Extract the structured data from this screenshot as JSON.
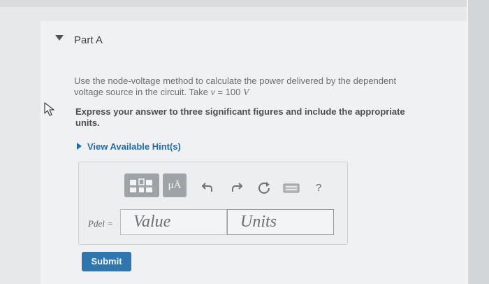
{
  "part": {
    "title": "Part A"
  },
  "question": {
    "line1": "Use the node-voltage method to calculate the power delivered by the dependent",
    "line2_prefix": "voltage source in the circuit. Take ",
    "variable": "v",
    "equals_value": " = 100 ",
    "unit": "V"
  },
  "instruction": {
    "line1": "Express your answer to three significant figures and include the appropriate",
    "line2": "units."
  },
  "hints": {
    "label": "View Available Hint(s)"
  },
  "toolbar": {
    "units_label": "μÅ",
    "help_label": "?"
  },
  "answer": {
    "variable_label": "Pdel =",
    "value_placeholder": "Value",
    "units_placeholder": "Units"
  },
  "submit": {
    "label": "Submit"
  },
  "colors": {
    "link_blue": "#1b6cb5",
    "submit_blue": "#2f76ae",
    "toolbar_gray": "#9ea3a8"
  }
}
